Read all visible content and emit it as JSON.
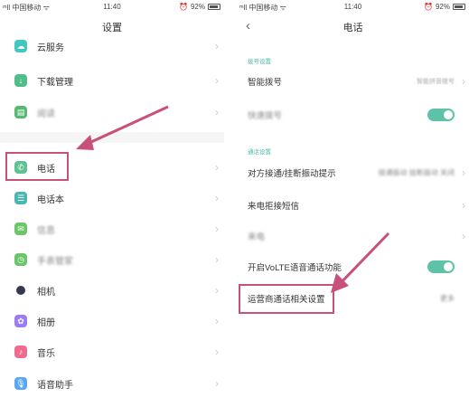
{
  "left": {
    "status": {
      "carrier": "ᵐll 中国移动 ᯤ",
      "time": "11:40",
      "battery": "92%"
    },
    "title": "设置",
    "items": [
      {
        "label": "云服务",
        "icon": "cloud-icon",
        "color": "#3fc7c0"
      },
      {
        "label": "下载管理",
        "icon": "download-icon",
        "color": "#4fbf8a"
      },
      {
        "label": "阅读",
        "icon": "book-icon",
        "color": "#58b873"
      },
      {
        "label": "电话",
        "icon": "phone-icon",
        "color": "#5fc191"
      },
      {
        "label": "电话本",
        "icon": "contacts-icon",
        "color": "#4ab6b0"
      },
      {
        "label": "信息",
        "icon": "message-icon",
        "color": "#6cc667"
      },
      {
        "label": "手表管家",
        "icon": "watch-icon",
        "color": "#6ac46a"
      },
      {
        "label": "相机",
        "icon": "camera-icon",
        "color": "#333a4d"
      },
      {
        "label": "相册",
        "icon": "gallery-icon",
        "color": "#9b7cf2"
      },
      {
        "label": "音乐",
        "icon": "music-icon",
        "color": "#f06b8e"
      },
      {
        "label": "语音助手",
        "icon": "mic-icon",
        "color": "#58a7f2"
      }
    ]
  },
  "right": {
    "status": {
      "carrier": "ᵐll 中国移动 ᯤ",
      "time": "11:40",
      "battery": "92%"
    },
    "title": "电话",
    "back": "‹",
    "section1": "拨号设置",
    "smart_dial": {
      "label": "智能拨号",
      "value": "智能拼音拨号"
    },
    "blurred_toggle": {
      "label": "快速拨号"
    },
    "section2": "通话设置",
    "vibrate": {
      "label": "对方接通/挂断振动提示",
      "value": "接通振动 挂断振动 关闭"
    },
    "reject_sms": {
      "label": "来电拒接短信"
    },
    "blurred_row": {
      "label": "来电"
    },
    "volte": {
      "label": "开启VoLTE语音通话功能"
    },
    "carrier_settings": {
      "label": "运营商通话相关设置",
      "value": "更多"
    }
  },
  "accent": "#c8507a",
  "toggle_color": "#5ec2a8"
}
